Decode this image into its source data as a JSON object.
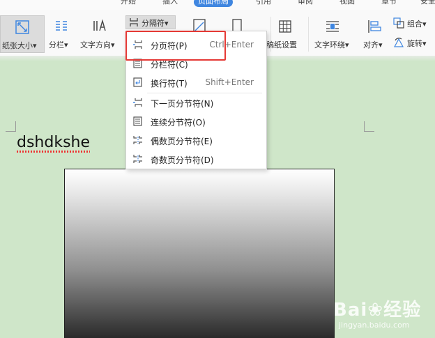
{
  "tabs": [
    {
      "label": "开始",
      "active": false
    },
    {
      "label": "插入",
      "active": false
    },
    {
      "label": "页面布局",
      "active": true
    },
    {
      "label": "引用",
      "active": false
    },
    {
      "label": "审阅",
      "active": false
    },
    {
      "label": "视图",
      "active": false
    },
    {
      "label": "章节",
      "active": false
    },
    {
      "label": "安全",
      "active": false
    }
  ],
  "ribbon": {
    "paper_size": "纸张大小",
    "columns": "分栏",
    "text_direction": "文字方向",
    "separator": "分隔符",
    "manuscript": "稿纸设置",
    "text_wrap": "文字环绕",
    "align": "对齐",
    "group": "组合",
    "rotate": "旋转"
  },
  "menu": {
    "items": [
      {
        "label": "分页符(P)",
        "shortcut": "Ctrl+Enter"
      },
      {
        "label": "分栏符(C)",
        "shortcut": ""
      },
      {
        "label": "换行符(T)",
        "shortcut": "Shift+Enter"
      },
      {
        "label": "下一页分节符(N)",
        "shortcut": ""
      },
      {
        "label": "连续分节符(O)",
        "shortcut": ""
      },
      {
        "label": "偶数页分节符(E)",
        "shortcut": ""
      },
      {
        "label": "奇数页分节符(D)",
        "shortcut": ""
      }
    ]
  },
  "document": {
    "text": "dshdkshe"
  },
  "watermark": {
    "brand": "Bai",
    "brand2": "经验",
    "url": "jingyan.baidu.com"
  },
  "colors": {
    "accent": "#3f86e0",
    "highlight": "#e53935",
    "page_bg": "#cfe6c9"
  }
}
